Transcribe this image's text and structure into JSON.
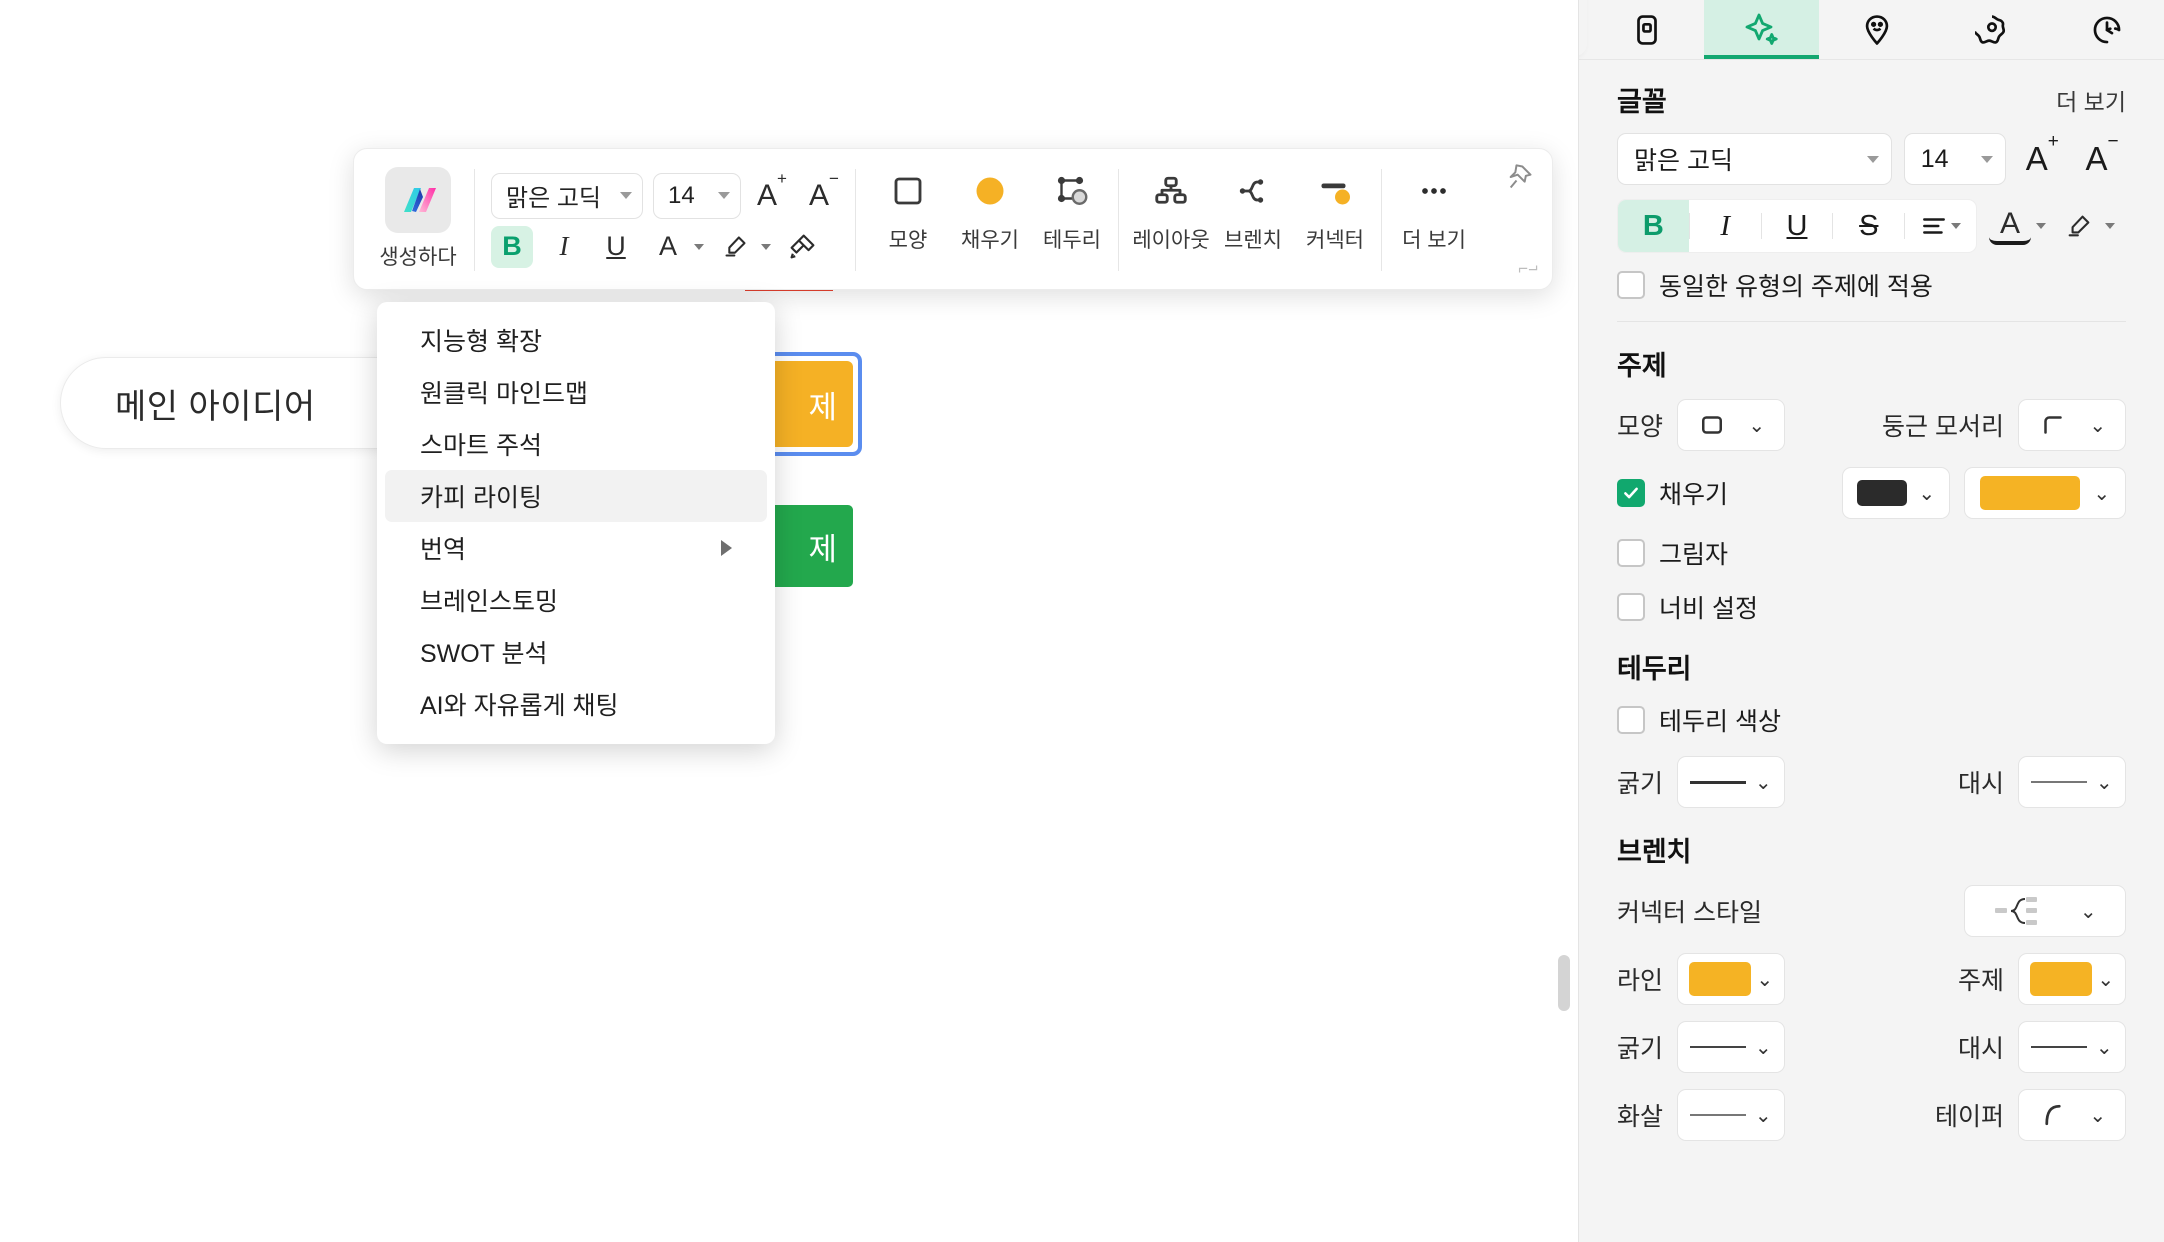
{
  "canvas": {
    "root_node": {
      "text": "메인 아이디어",
      "name": "root-node"
    },
    "orange_node": {
      "text": "제",
      "fill": "#F5B125",
      "selected": true,
      "selection_color": "#5B8DEF"
    },
    "green_node": {
      "text": "제",
      "fill": "#23A84D"
    }
  },
  "toolbar": {
    "ai_label": "생성하다",
    "font_name": "맑은 고딕",
    "font_size": "14",
    "increase_font": "A",
    "decrease_font": "A",
    "bold": "B",
    "italic": "I",
    "underline": "U",
    "font_color": "A",
    "tools": [
      {
        "label": "모양",
        "icon": "shape-square-icon"
      },
      {
        "label": "채우기",
        "icon": "fill-circle-icon"
      },
      {
        "label": "테두리",
        "icon": "border-icon"
      },
      {
        "label": "레이아웃",
        "icon": "layout-icon"
      },
      {
        "label": "브렌치",
        "icon": "branch-icon"
      },
      {
        "label": "커넥터",
        "icon": "connector-icon"
      },
      {
        "label": "더 보기",
        "icon": "more-dots-icon"
      }
    ]
  },
  "ai_menu": {
    "items": [
      {
        "label": "지능형 확장",
        "highlighted": false,
        "submenu": false
      },
      {
        "label": "원클릭 마인드맵",
        "highlighted": false,
        "submenu": false
      },
      {
        "label": "스마트 주석",
        "highlighted": false,
        "submenu": false
      },
      {
        "label": "카피 라이팅",
        "highlighted": true,
        "submenu": false
      },
      {
        "label": "번역",
        "highlighted": false,
        "submenu": true
      },
      {
        "label": "브레인스토밍",
        "highlighted": false,
        "submenu": false
      },
      {
        "label": "SWOT 분석",
        "highlighted": false,
        "submenu": false
      },
      {
        "label": "AI와 자유롭게 채팅",
        "highlighted": false,
        "submenu": false
      }
    ]
  },
  "panel": {
    "tabs": [
      {
        "icon": "style-card-icon",
        "active": false
      },
      {
        "icon": "sparkle-ai-icon",
        "active": true
      },
      {
        "icon": "sticker-smiley-icon",
        "active": false
      },
      {
        "icon": "badge-star-icon",
        "active": false
      },
      {
        "icon": "history-clock-icon",
        "active": false
      }
    ],
    "font_section": {
      "title": "글꼴",
      "more_label": "더 보기",
      "font_name": "맑은 고딕",
      "font_size": "14",
      "increase_label": "A",
      "decrease_label": "A",
      "bold": "B",
      "italic": "I",
      "underline": "U",
      "strike": "S",
      "font_color": "A",
      "apply_same_type": "동일한 유형의 주제에 적용",
      "apply_same_type_checked": false
    },
    "topic_section": {
      "title": "주제",
      "shape_label": "모양",
      "corner_label": "둥근 모서리",
      "fill_label": "채우기",
      "fill_checked": true,
      "fill_color_dark": "#2b2b2b",
      "fill_color_accent": "#F5B324",
      "shadow_label": "그림자",
      "shadow_checked": false,
      "width_label": "너비 설정",
      "width_checked": false
    },
    "border_section": {
      "title": "테두리",
      "border_color_label": "테두리 색상",
      "border_color_checked": false,
      "weight_label": "굵기",
      "dash_label": "대시"
    },
    "branch_section": {
      "title": "브렌치",
      "connector_style_label": "커넥터 스타일",
      "line_label": "라인",
      "line_color": "#F5B324",
      "topic_label": "주제",
      "topic_color": "#F5B324",
      "weight_label": "굵기",
      "dash_label": "대시",
      "arrow_label": "화살",
      "taper_label": "테이퍼"
    },
    "collapse_icon": "chevron-right-icon"
  }
}
